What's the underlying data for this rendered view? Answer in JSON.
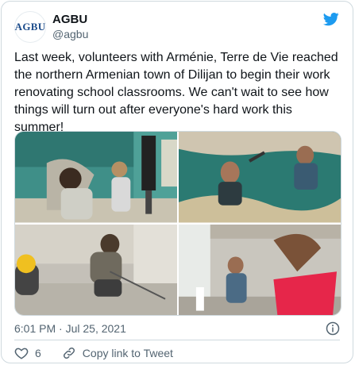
{
  "account": {
    "avatar_text": "AGBU",
    "display_name": "AGBU",
    "handle": "@agbu"
  },
  "tweet": {
    "text": "Last week, volunteers with Arménie, Terre de Vie reached the northern Armenian town of Dilijan to begin their work renovating school classrooms. We can't wait to see how things will turn out after everyone's hard work this summer!",
    "timestamp": "6:01 PM · Jul 25, 2021"
  },
  "actions": {
    "like_count": "6",
    "copy_link_label": "Copy link to Tweet"
  },
  "icons": {
    "platform": "twitter-bird-icon",
    "info": "info-icon",
    "like": "heart-icon",
    "link": "link-icon"
  },
  "colors": {
    "brand_blue": "#1d9bf0",
    "text_primary": "#0f1419",
    "text_secondary": "#536471",
    "border": "#cfd9de"
  }
}
